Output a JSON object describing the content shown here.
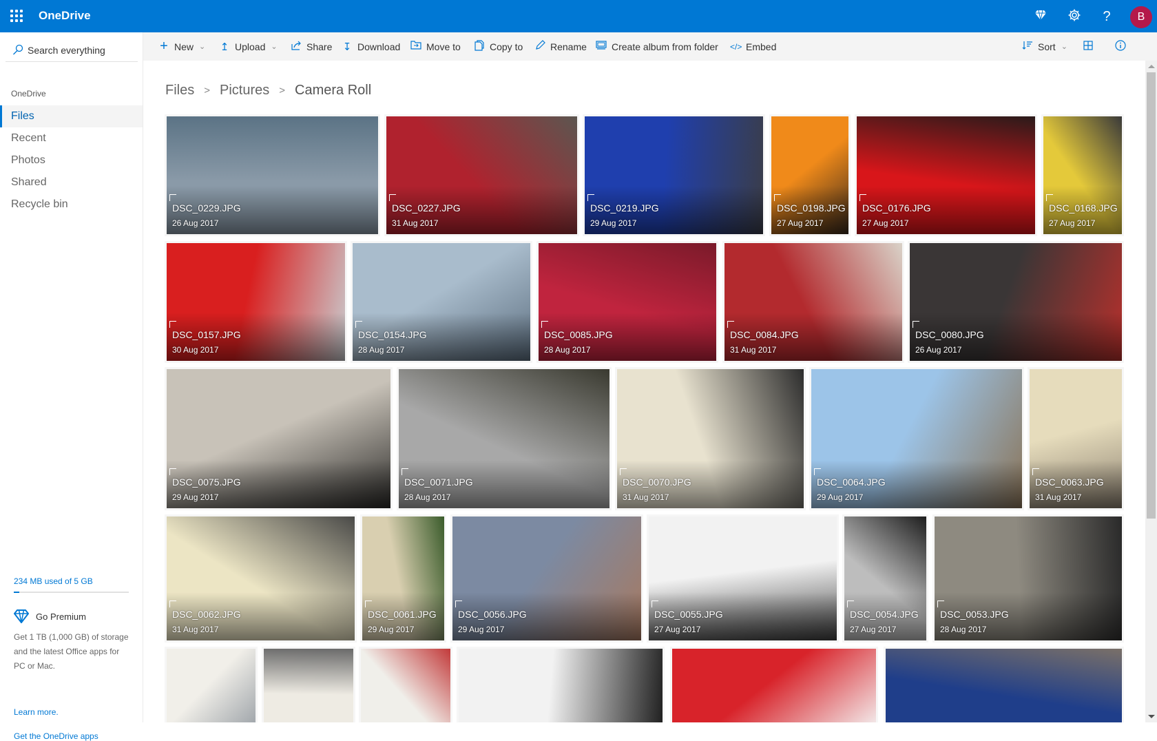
{
  "app": {
    "title": "OneDrive",
    "avatar_initial": "B",
    "avatar_color": "#b4194a",
    "brand_color": "#0078d4",
    "header_icons": [
      "diamond-icon",
      "gear-icon",
      "help-icon"
    ]
  },
  "sidebar": {
    "search_placeholder": "Search everything",
    "heading": "OneDrive",
    "items": [
      {
        "label": "Files",
        "active": true
      },
      {
        "label": "Recent",
        "active": false
      },
      {
        "label": "Photos",
        "active": false
      },
      {
        "label": "Shared",
        "active": false
      },
      {
        "label": "Recycle bin",
        "active": false
      }
    ],
    "quota_text": "234 MB used of 5 GB",
    "quota_fraction": 0.047,
    "premium_title": "Go Premium",
    "premium_desc": "Get 1 TB (1,000 GB) of storage and the latest Office apps for PC or Mac.",
    "learn_more": "Learn more.",
    "get_apps": "Get the OneDrive apps"
  },
  "toolbar": {
    "new": "New",
    "upload": "Upload",
    "share": "Share",
    "download": "Download",
    "move_to": "Move to",
    "copy_to": "Copy to",
    "rename": "Rename",
    "create_album": "Create album from folder",
    "embed": "Embed",
    "sort": "Sort"
  },
  "breadcrumb": [
    "Files",
    "Pictures",
    "Camera Roll"
  ],
  "photos": [
    {
      "name": "DSC_0229.JPG",
      "date": "26 Aug 2017",
      "c1": "#8a9aa8",
      "c2": "#5b7385"
    },
    {
      "name": "DSC_0227.JPG",
      "date": "31 Aug 2017",
      "c1": "#b0222e",
      "c2": "#5c5650"
    },
    {
      "name": "DSC_0219.JPG",
      "date": "29 Aug 2017",
      "c1": "#1f3fae",
      "c2": "#3a3d4a"
    },
    {
      "name": "DSC_0198.JPG",
      "date": "27 Aug 2017",
      "c1": "#f08a1a",
      "c2": "#3b2a1c"
    },
    {
      "name": "DSC_0176.JPG",
      "date": "27 Aug 2017",
      "c1": "#d8161a",
      "c2": "#2a1a1a"
    },
    {
      "name": "DSC_0168.JPG",
      "date": "27 Aug 2017",
      "c1": "#e4c93a",
      "c2": "#3a3a3a"
    },
    {
      "name": "DSC_0157.JPG",
      "date": "30 Aug 2017",
      "c1": "#d91f1f",
      "c2": "#c9cbce"
    },
    {
      "name": "DSC_0154.JPG",
      "date": "28 Aug 2017",
      "c1": "#a9bccc",
      "c2": "#5d6f80"
    },
    {
      "name": "DSC_0085.JPG",
      "date": "28 Aug 2017",
      "c1": "#c0243e",
      "c2": "#7a1a2a"
    },
    {
      "name": "DSC_0084.JPG",
      "date": "31 Aug 2017",
      "c1": "#b32a2e",
      "c2": "#d9d2c8"
    },
    {
      "name": "DSC_0080.JPG",
      "date": "26 Aug 2017",
      "c1": "#3a3636",
      "c2": "#b7302c"
    },
    {
      "name": "DSC_0075.JPG",
      "date": "29 Aug 2017",
      "c1": "#c8c2b8",
      "c2": "#2b2a28"
    },
    {
      "name": "DSC_0071.JPG",
      "date": "28 Aug 2017",
      "c1": "#a8a8a8",
      "c2": "#3a3a30"
    },
    {
      "name": "DSC_0070.JPG",
      "date": "31 Aug 2017",
      "c1": "#e8e2cf",
      "c2": "#2d2d2d"
    },
    {
      "name": "DSC_0064.JPG",
      "date": "29 Aug 2017",
      "c1": "#9cc4e8",
      "c2": "#8a7458"
    },
    {
      "name": "DSC_0063.JPG",
      "date": "31 Aug 2017",
      "c1": "#e6dcbc",
      "c2": "#8b8070"
    },
    {
      "name": "DSC_0062.JPG",
      "date": "31 Aug 2017",
      "c1": "#ece5c4",
      "c2": "#4a4a48"
    },
    {
      "name": "DSC_0061.JPG",
      "date": "29 Aug 2017",
      "c1": "#d9cfb0",
      "c2": "#3b5c2c"
    },
    {
      "name": "DSC_0056.JPG",
      "date": "29 Aug 2017",
      "c1": "#7c8aa2",
      "c2": "#a77960"
    },
    {
      "name": "DSC_0055.JPG",
      "date": "27 Aug 2017",
      "c1": "#f2f2f2",
      "c2": "#404040"
    },
    {
      "name": "DSC_0054.JPG",
      "date": "27 Aug 2017",
      "c1": "#bdbdbd",
      "c2": "#1e1e1e"
    },
    {
      "name": "DSC_0053.JPG",
      "date": "28 Aug 2017",
      "c1": "#8e8a80",
      "c2": "#2a2a2a"
    },
    {
      "name": "",
      "date": "",
      "c1": "#f1efe9",
      "c2": "#9aa0a6"
    },
    {
      "name": "",
      "date": "",
      "c1": "#eeebe3",
      "c2": "#6a6a6a"
    },
    {
      "name": "",
      "date": "",
      "c1": "#f0efea",
      "c2": "#c23a3a"
    },
    {
      "name": "",
      "date": "",
      "c1": "#f2f2f2",
      "c2": "#202020"
    },
    {
      "name": "",
      "date": "",
      "c1": "#d8232a",
      "c2": "#f4f4f4"
    },
    {
      "name": "",
      "date": "",
      "c1": "#1f3e8a",
      "c2": "#7a7068"
    }
  ]
}
